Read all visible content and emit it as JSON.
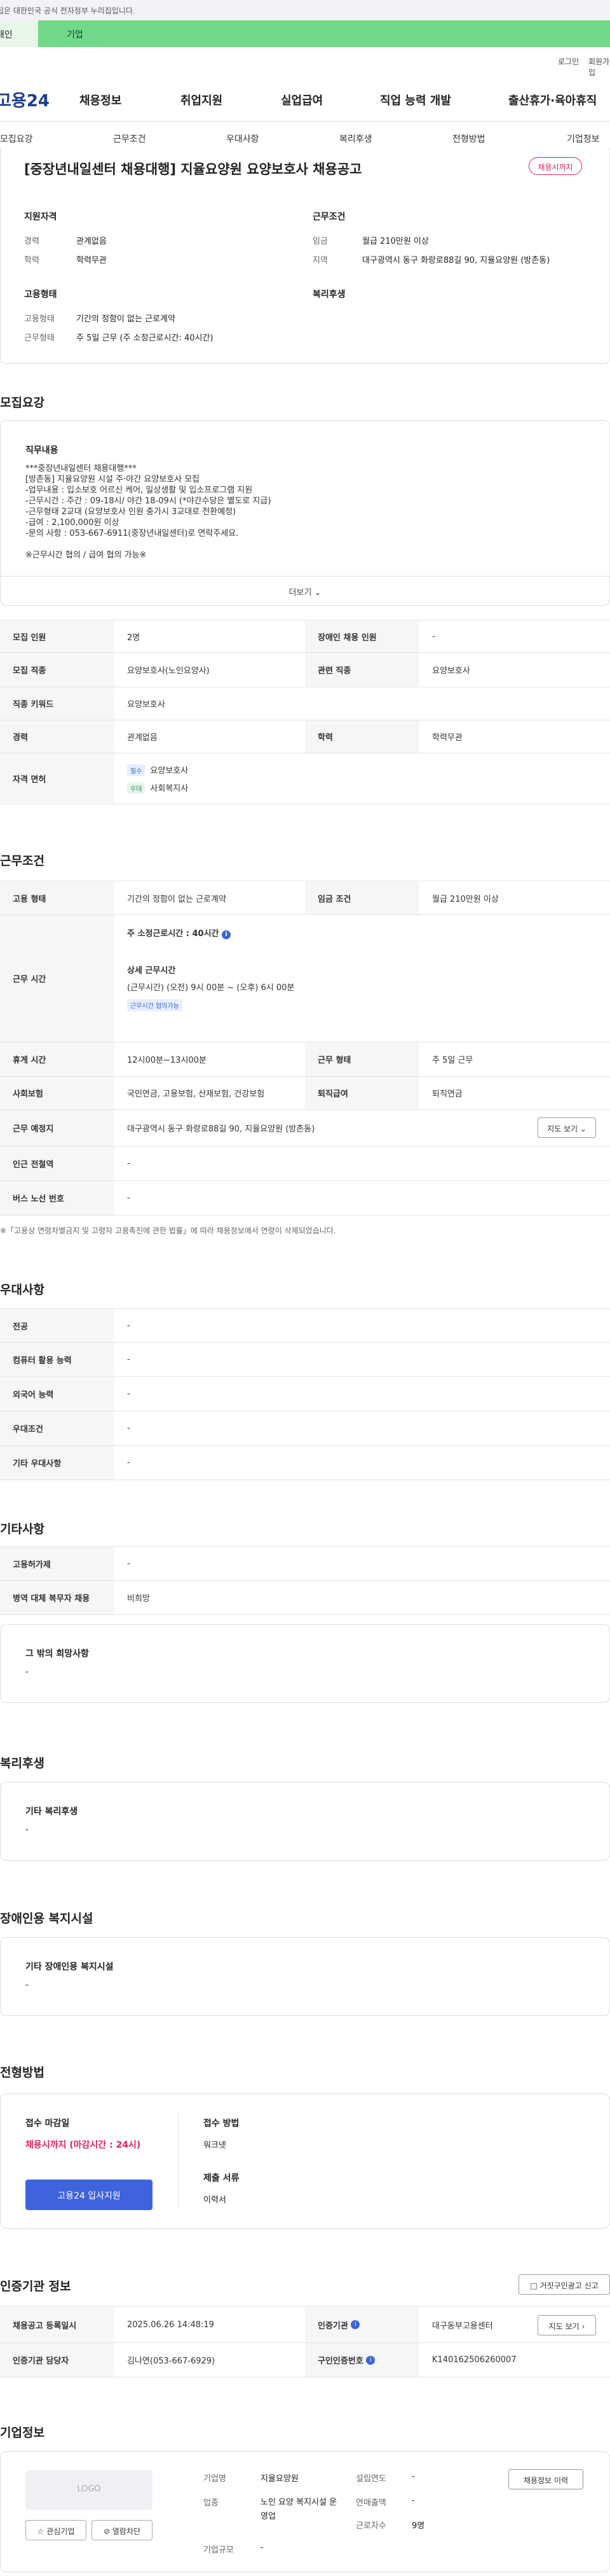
{
  "gov_banner": "이 누리집은 대한민국 공식 전자정부 누리집입니다.",
  "audience": {
    "personal": "개인",
    "corporate": "기업"
  },
  "util": {
    "login": "로그인",
    "join": "회원가입"
  },
  "logo": "고용24",
  "gnb": [
    "채용정보",
    "취업지원",
    "실업급여",
    "직업 능력 개발",
    "출산휴가·육아휴직"
  ],
  "subnav": [
    "모집요강",
    "근무조건",
    "우대사항",
    "복리후생",
    "전형방법",
    "기업정보"
  ],
  "job": {
    "title": "[중장년내일센터 채용대행] 지율요양원 요양보호사 채용공고",
    "status": "채용시까지",
    "qual_heading": "지원자격",
    "cond_heading": "근무조건",
    "emp_heading": "고용형태",
    "welfare_heading": "복리후생",
    "career_label": "경력",
    "career_value": "관계없음",
    "edu_label": "학력",
    "edu_value": "학력무관",
    "wage_label": "임금",
    "wage_value": "월급 210만원 이상",
    "region_label": "지역",
    "region_value": "대구광역시 동구 화랑로88길 90, 지율요양원 (방촌동)",
    "emptype_label": "고용형태",
    "emptype_value": "기간의 정함이 없는 근로계약",
    "worktype_label": "근무형태",
    "worktype_value": "주 5일 근무 (주 소정근로시간: 40시간)"
  },
  "recruit": {
    "section_title": "모집요강",
    "duty_heading": "직무내용",
    "duty_text": "***중장년내일센터 채용대행***\n[방촌동] 지율요양원 시설 주·야간 요양보호사 모집\n-업무내용 : 입소보호 어르신 케어, 일상생활 및 입소프로그램 지원\n-근무시간 : 주간 : 09-18시/ 야간 18-09시 (*야간수당은 별도로 지급)\n-근무형태 2교대 (요양보호사 인원 충가시 3교대로 전환예정)\n-급여 : 2,100,000원 이상\n-문의 사항 : 053-667-6911(중장년내일센터)로 연락주세요.\n\n※근무시간 협의 / 급여 협의 가능※",
    "more_label": "더보기",
    "headcount_label": "모집 인원",
    "headcount_value": "2명",
    "disabled_label": "장애인 채용 인원",
    "disabled_value": "-",
    "job_label": "모집 직종",
    "job_value": "요양보호사(노인요양사)",
    "related_label": "관련 직종",
    "related_value": "요양보호사",
    "keyword_label": "직종 키워드",
    "keyword_value": "요양보호사",
    "career_label": "경력",
    "career_value": "관계없음",
    "edu_label": "학력",
    "edu_value": "학력무관",
    "license_label": "자격 면허",
    "license_req_chip": "필수",
    "license_req": "요양보호사",
    "license_pref_chip": "우대",
    "license_pref": "사회복지사"
  },
  "conditions": {
    "section_title": "근무조건",
    "emptype_label": "고용 형태",
    "emptype_value": "기간의 정함이 없는 근로계약",
    "wage_label": "임금 조건",
    "wage_value": "월급 210만원 이상",
    "hours_label": "근무 시간",
    "hours_weekly": "주 소정근로시간 : 40시간",
    "hours_detail_title": "상세 근무시간",
    "hours_detail": "(근무시간) (오전) 9시 00분 ~ (오후) 6시 00분",
    "hours_chip": "근무시간 협의가능",
    "break_label": "휴게 시간",
    "break_value": "12시00분~13시00분",
    "worktype_label": "근무 형태",
    "worktype_value": "주 5일 근무",
    "insurance_label": "사회보험",
    "insurance_value": "국민연금, 고용보험, 산재보험, 건강보험",
    "retire_label": "퇴직급여",
    "retire_value": "퇴직연금",
    "place_label": "근무 예정지",
    "place_value": "대구광역시 동구 화랑로88길 90, 지율요양원 (방촌동)",
    "map_label": "지도 보기",
    "subway_label": "인근 전철역",
    "subway_value": "-",
    "bus_label": "버스 노선 번호",
    "bus_value": "-",
    "note": "※「고용상 연령차별금지 및 고령자 고용촉진에 관한 법률」에 따라 채용정보에서 연령이 삭제되었습니다."
  },
  "preference": {
    "section_title": "우대사항",
    "major_label": "전공",
    "major_value": "-",
    "computer_label": "컴퓨터 활용 능력",
    "computer_value": "-",
    "lang_label": "외국어 능력",
    "lang_value": "-",
    "cond_label": "우대조건",
    "cond_value": "-",
    "etc_label": "기타 우대사항",
    "etc_value": "-"
  },
  "etc": {
    "section_title": "기타사항",
    "hire_label": "고용허가제",
    "hire_value": "-",
    "military_label": "병역 대체 복무자 채용",
    "military_value": "비희망",
    "other_heading": "그 밖의 희망사항",
    "other_value": "-"
  },
  "welfare": {
    "section_title": "복리후생",
    "heading": "기타 복리후생",
    "value": "-"
  },
  "disability": {
    "section_title": "장애인용 복지시설",
    "heading": "기타 장애인용 복지시설",
    "value": "-"
  },
  "selection": {
    "section_title": "전형방법",
    "deadline_label": "접수 마감일",
    "deadline_value": "채용시까지 (마감시간 : 24시)",
    "apply_button": "고용24 입사지원",
    "method_label": "접수 방법",
    "method_value": "워크넷",
    "docs_label": "제출 서류",
    "docs_value": "이력서"
  },
  "agency": {
    "section_title": "인증기관 정보",
    "report_button": "거짓구인광고 신고",
    "reg_label": "채용공고 등록일시",
    "reg_value": "2025.06.26 14:48:19",
    "agency_label": "인증기관",
    "agency_value": "대구동부고용센터",
    "map_label": "지도 보기",
    "manager_label": "인증기관 담당자",
    "manager_value": "김나연(053-667-6929)",
    "auth_label": "구인인증번호",
    "auth_value": "K140162506260007"
  },
  "company": {
    "section_title": "기업정보",
    "logo_placeholder": "LOGO",
    "follow_button": "관심기업",
    "block_button": "열람차단",
    "name_label": "기업명",
    "name_value": "지율요양원",
    "industry_label": "업종",
    "industry_value": "노인 요양 복지시설 운영업",
    "size_label": "기업규모",
    "size_value": "-",
    "founded_label": "설립연도",
    "founded_value": "-",
    "sales_label": "연매출액",
    "sales_value": "-",
    "employees_label": "근로자수",
    "employees_value": "9명",
    "history_button": "채용정보 이력"
  }
}
